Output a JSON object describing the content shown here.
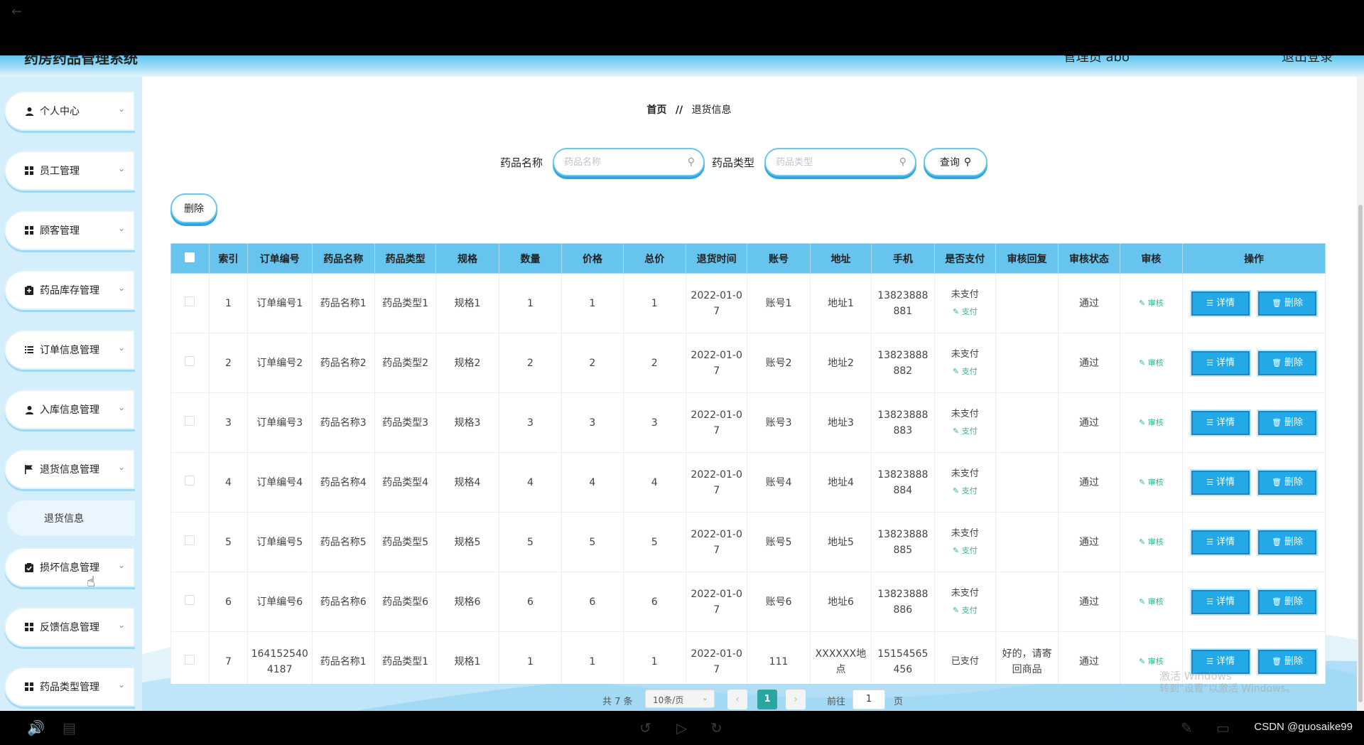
{
  "app": {
    "title": "药房药品管理系统",
    "admin_label": "管理员 abo",
    "logout_label": "退出登录"
  },
  "sidebar": {
    "items": [
      {
        "label": "个人中心",
        "icon": "user-icon"
      },
      {
        "label": "员工管理",
        "icon": "grid-icon"
      },
      {
        "label": "顾客管理",
        "icon": "grid-icon"
      },
      {
        "label": "药品库存管理",
        "icon": "clipboard-icon"
      },
      {
        "label": "订单信息管理",
        "icon": "list-icon"
      },
      {
        "label": "入库信息管理",
        "icon": "user-icon"
      },
      {
        "label": "退货信息管理",
        "icon": "flag-icon"
      },
      {
        "label": "损坏信息管理",
        "icon": "clipboard-check-icon"
      },
      {
        "label": "反馈信息管理",
        "icon": "grid-icon"
      },
      {
        "label": "药品类型管理",
        "icon": "grid-icon"
      }
    ],
    "submenu_active": "退货信息"
  },
  "breadcrumb": {
    "home": "首页",
    "sep": "//",
    "current": "退货信息"
  },
  "search": {
    "name_label": "药品名称",
    "name_placeholder": "药品名称",
    "type_label": "药品类型",
    "type_placeholder": "药品类型",
    "query_label": "查询"
  },
  "toolbar": {
    "delete_label": "删除"
  },
  "table": {
    "columns": [
      "",
      "索引",
      "订单编号",
      "药品名称",
      "药品类型",
      "规格",
      "数量",
      "价格",
      "总价",
      "退货时间",
      "账号",
      "地址",
      "手机",
      "是否支付",
      "审核回复",
      "审核状态",
      "审核",
      "操作"
    ],
    "pay_action": "支付",
    "audit_action": "审核",
    "detail_label": "详情",
    "delete_label": "删除",
    "rows": [
      {
        "index": "1",
        "order_no": "订单编号1",
        "drug_name": "药品名称1",
        "drug_type": "药品类型1",
        "spec": "规格1",
        "qty": "1",
        "price": "1",
        "total": "1",
        "return_time": "2022-01-07",
        "account": "账号1",
        "address": "地址1",
        "phone": "13823888881",
        "paid": "未支付",
        "show_pay": true,
        "reply": "",
        "status": "通过"
      },
      {
        "index": "2",
        "order_no": "订单编号2",
        "drug_name": "药品名称2",
        "drug_type": "药品类型2",
        "spec": "规格2",
        "qty": "2",
        "price": "2",
        "total": "2",
        "return_time": "2022-01-07",
        "account": "账号2",
        "address": "地址2",
        "phone": "13823888882",
        "paid": "未支付",
        "show_pay": true,
        "reply": "",
        "status": "通过"
      },
      {
        "index": "3",
        "order_no": "订单编号3",
        "drug_name": "药品名称3",
        "drug_type": "药品类型3",
        "spec": "规格3",
        "qty": "3",
        "price": "3",
        "total": "3",
        "return_time": "2022-01-07",
        "account": "账号3",
        "address": "地址3",
        "phone": "13823888883",
        "paid": "未支付",
        "show_pay": true,
        "reply": "",
        "status": "通过"
      },
      {
        "index": "4",
        "order_no": "订单编号4",
        "drug_name": "药品名称4",
        "drug_type": "药品类型4",
        "spec": "规格4",
        "qty": "4",
        "price": "4",
        "total": "4",
        "return_time": "2022-01-07",
        "account": "账号4",
        "address": "地址4",
        "phone": "13823888884",
        "paid": "未支付",
        "show_pay": true,
        "reply": "",
        "status": "通过"
      },
      {
        "index": "5",
        "order_no": "订单编号5",
        "drug_name": "药品名称5",
        "drug_type": "药品类型5",
        "spec": "规格5",
        "qty": "5",
        "price": "5",
        "total": "5",
        "return_time": "2022-01-07",
        "account": "账号5",
        "address": "地址5",
        "phone": "13823888885",
        "paid": "未支付",
        "show_pay": true,
        "reply": "",
        "status": "通过"
      },
      {
        "index": "6",
        "order_no": "订单编号6",
        "drug_name": "药品名称6",
        "drug_type": "药品类型6",
        "spec": "规格6",
        "qty": "6",
        "price": "6",
        "total": "6",
        "return_time": "2022-01-07",
        "account": "账号6",
        "address": "地址6",
        "phone": "13823888886",
        "paid": "未支付",
        "show_pay": true,
        "reply": "",
        "status": "通过"
      },
      {
        "index": "7",
        "order_no": "1641525404187",
        "drug_name": "药品名称1",
        "drug_type": "药品类型1",
        "spec": "规格1",
        "qty": "1",
        "price": "1",
        "total": "1",
        "return_time": "2022-01-07",
        "account": "111",
        "address": "XXXXXX地点",
        "phone": "15154565456",
        "paid": "已支付",
        "show_pay": false,
        "reply": "好的，请寄回商品",
        "status": "通过"
      }
    ]
  },
  "pagination": {
    "total": "共 7 条",
    "page_size": "10条/页",
    "current_page": "1",
    "goto_label": "前往",
    "goto_value": "1",
    "page_unit": "页"
  },
  "watermark": {
    "line1": "激活 Windows",
    "line2": "转到\"设置\"以激活 Windows。"
  },
  "credit": "CSDN @guosaike99",
  "colors": {
    "accent": "#23a9e8",
    "header": "#67c4ee",
    "sidebar_bg": "#d4eefb",
    "page_active": "#2aa5a0",
    "link_green": "#2eb88e"
  }
}
